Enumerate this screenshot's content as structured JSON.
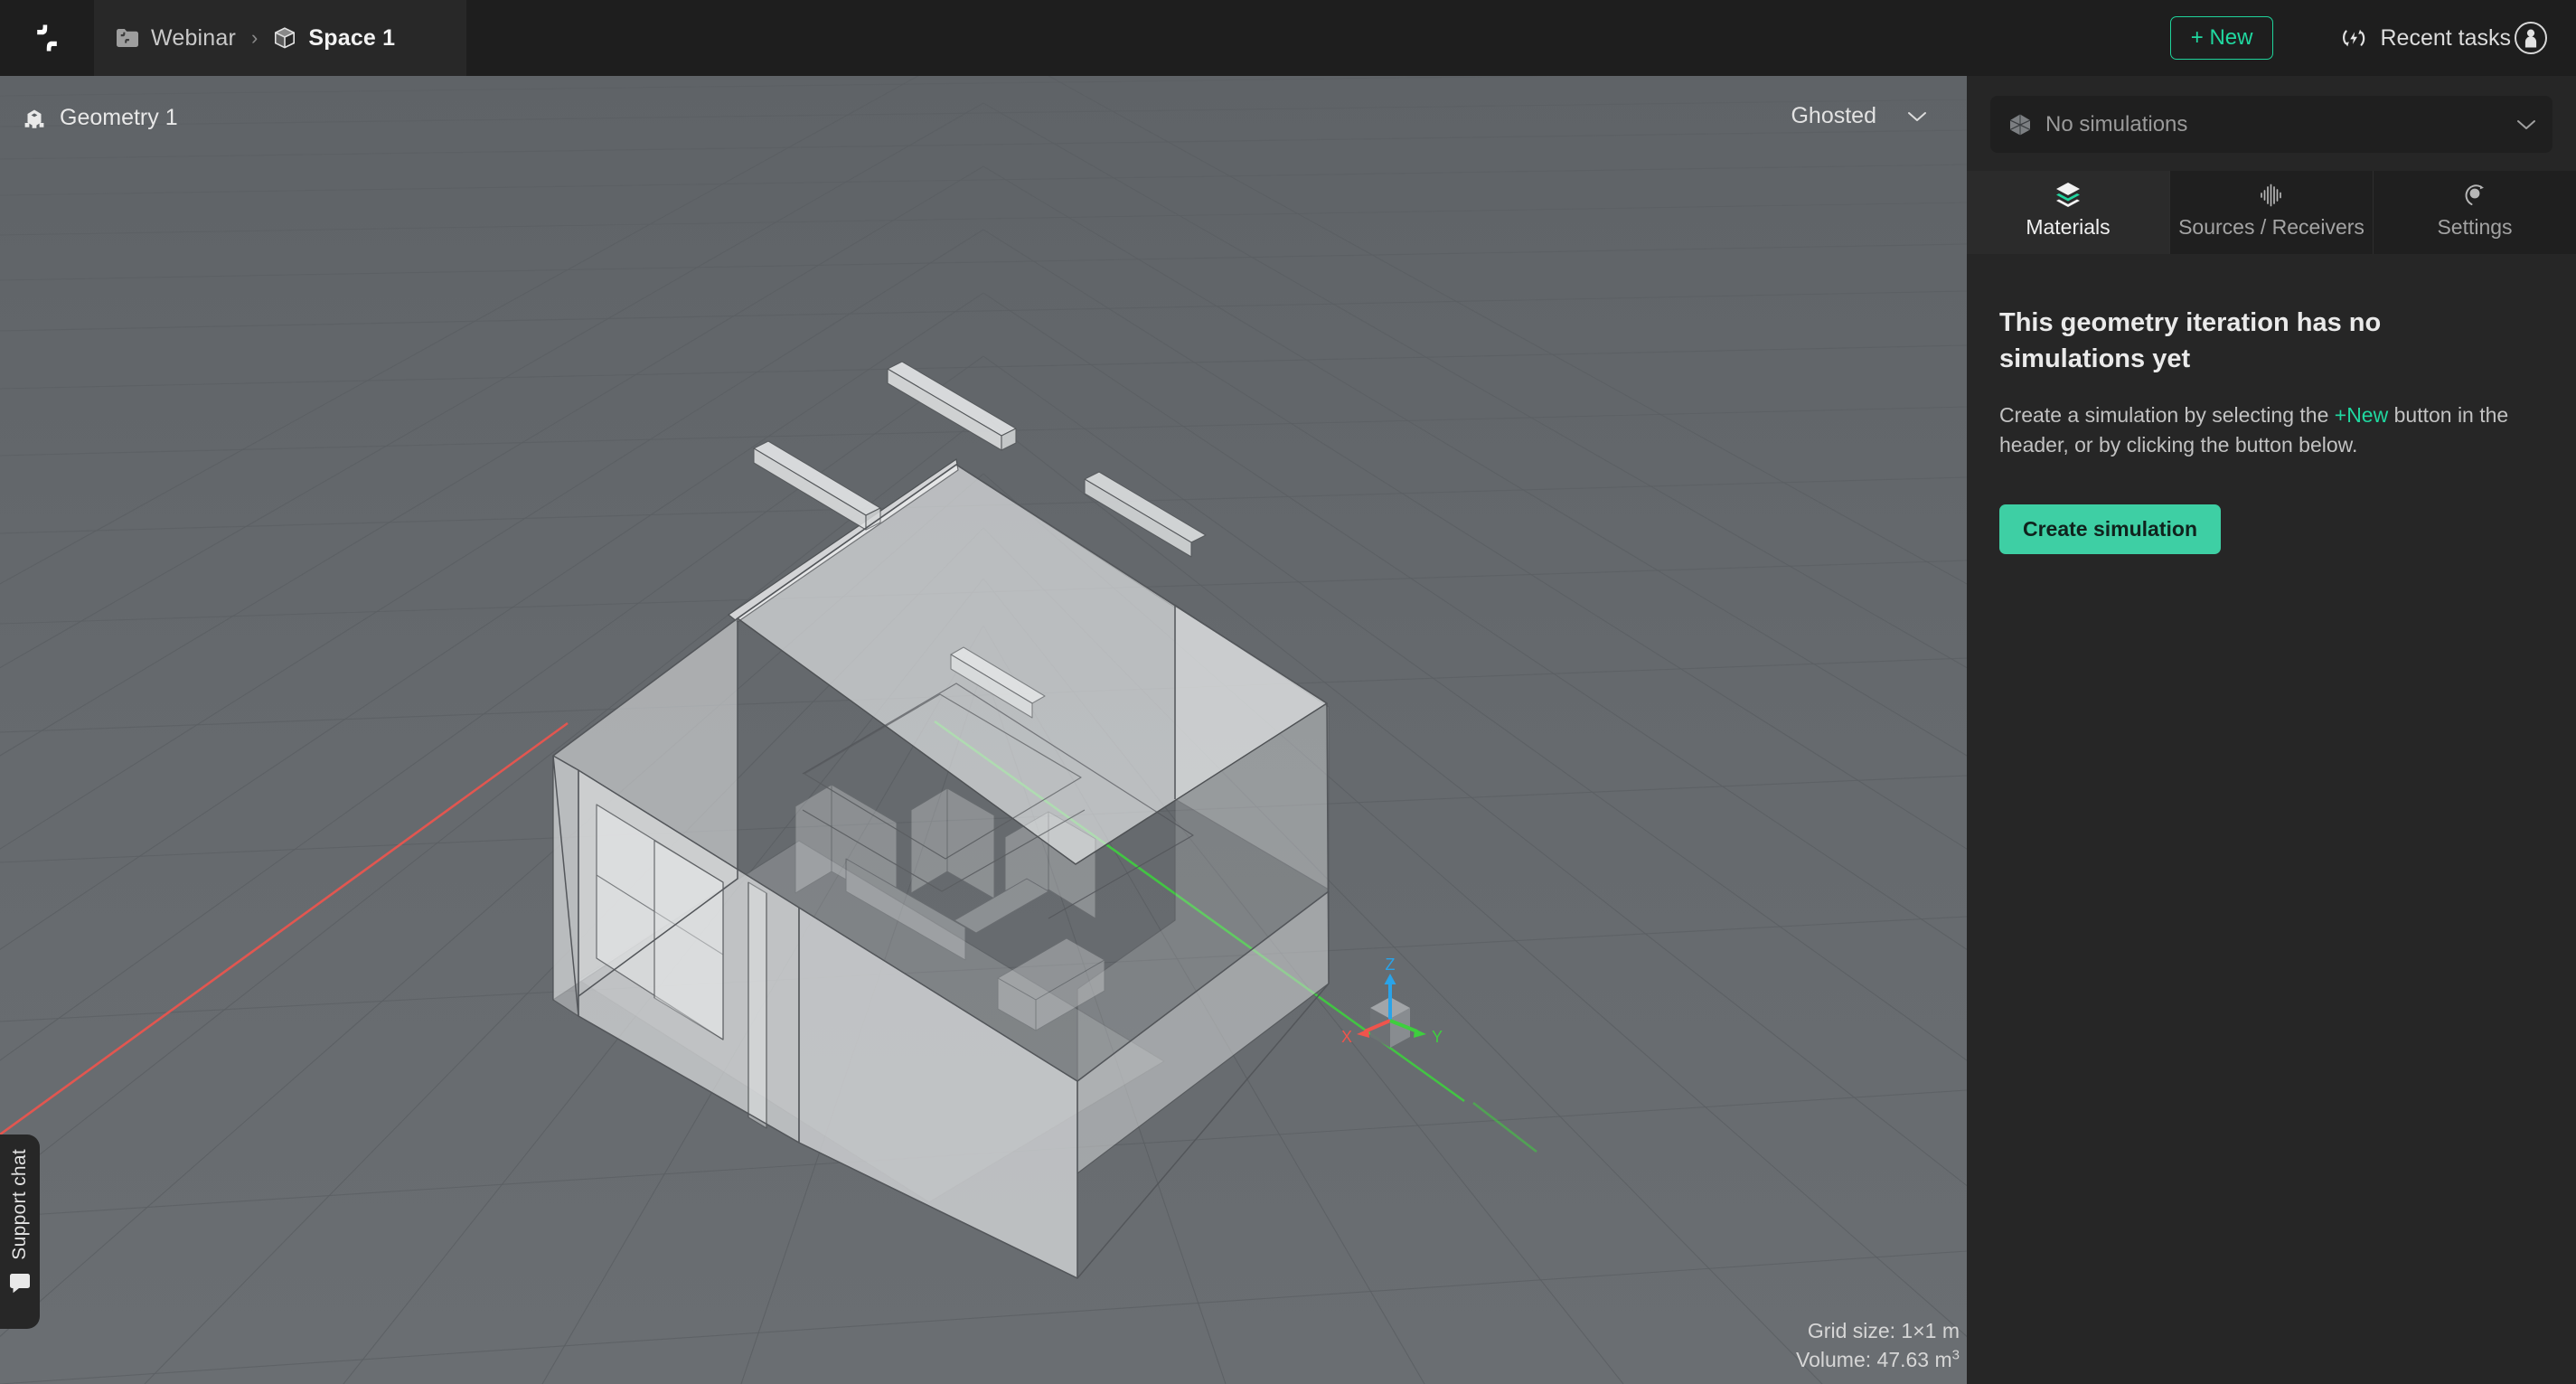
{
  "app": {
    "logo_icon": "app-logo-mark"
  },
  "topbar": {
    "breadcrumb": [
      {
        "label": "Webinar",
        "icon": "folder-icon",
        "active": false
      },
      {
        "label": "Space 1",
        "icon": "cube-icon",
        "active": true
      }
    ],
    "separator": "›",
    "new_button": "+ New",
    "recent_tasks": "Recent tasks",
    "recent_tasks_icon": "refresh-bolt-icon",
    "avatar_icon": "user-avatar-icon"
  },
  "viewport": {
    "geometry_label": "Geometry 1",
    "geometry_icon": "geometry-node-icon",
    "shading_mode": "Ghosted",
    "shading_chevron_icon": "chevron-down-icon",
    "grid_size": "Grid size: 1×1 m",
    "volume_label": "Volume: 47.63 m",
    "volume_exponent": "3",
    "axes": {
      "x": "X",
      "y": "Y",
      "z": "Z"
    },
    "axis_colors": {
      "x": "#f0544c",
      "y": "#3ecf3e",
      "z": "#2aa3e8"
    },
    "background_color": "#65696d"
  },
  "support": {
    "label": "Support chat",
    "icon": "chat-bubble-icon"
  },
  "right_panel": {
    "simulation_select": {
      "value": "No simulations",
      "icon": "polyhedron-icon",
      "chevron_icon": "chevron-down-icon"
    },
    "tabs": [
      {
        "label": "Materials",
        "icon": "layers-icon",
        "active": true
      },
      {
        "label": "Sources / Receivers",
        "icon": "waveform-icon",
        "active": false
      },
      {
        "label": "Settings",
        "icon": "mic-icon",
        "active": false
      }
    ],
    "empty_state": {
      "title": "This geometry iteration has no simulations yet",
      "desc_part1": "Create a simulation by selecting the ",
      "desc_accent": "+New",
      "desc_part2": " button in the header, or by clicking the button below.",
      "cta": "Create simulation"
    }
  },
  "colors": {
    "accent": "#20d8a0",
    "cta": "#3ecfa4",
    "panel_bg": "#262626",
    "topbar_bg": "#1e1e1e"
  }
}
